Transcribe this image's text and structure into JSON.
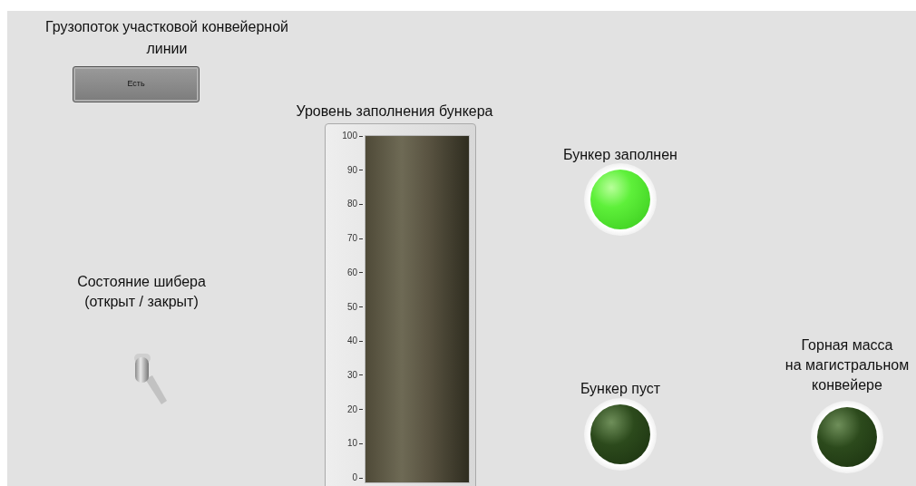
{
  "flow": {
    "label": "Грузопоток участковой конвейерной\nлинии",
    "button": "Есть"
  },
  "tank": {
    "label": "Уровень заполнения бункера",
    "level": 1,
    "scale": [
      "100",
      "90",
      "80",
      "70",
      "60",
      "50",
      "40",
      "30",
      "20",
      "10",
      "0"
    ]
  },
  "gate": {
    "label": "Состояние шибера\n(открыт / закрыт)",
    "on": true
  },
  "leds": [
    {
      "label": "Бункер заполнен",
      "on": true
    },
    {
      "label": "Бункер пуст",
      "on": false
    },
    {
      "label": "Горная масса\nна магистральном\nконвейере",
      "on": false
    }
  ]
}
